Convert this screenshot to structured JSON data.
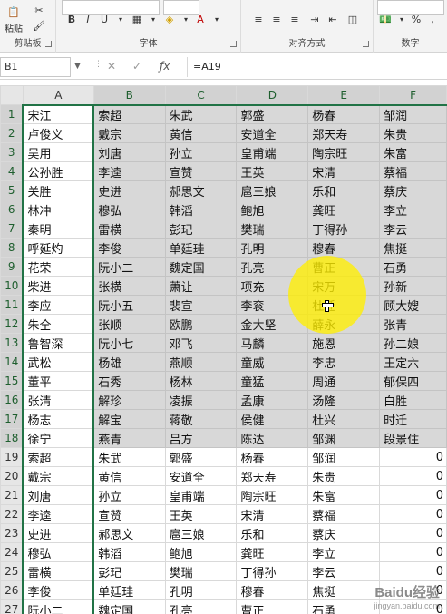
{
  "ribbon": {
    "clipboard_label": "剪贴板",
    "paste_label": "粘贴",
    "font_label": "字体",
    "alignment_label": "对齐方式",
    "number_label": "数字",
    "bold": "B",
    "italic": "I",
    "underline": "U",
    "font_color": "A",
    "percent": "%",
    "comma": ","
  },
  "formula_bar": {
    "name_box": "B1",
    "formula": "=A19"
  },
  "sheet": {
    "columns": [
      "A",
      "B",
      "C",
      "D",
      "E",
      "F"
    ],
    "rows": [
      {
        "n": "1",
        "cells": [
          "宋江",
          "索超",
          "朱武",
          "郭盛",
          "杨春",
          "邹润"
        ]
      },
      {
        "n": "2",
        "cells": [
          "卢俊义",
          "戴宗",
          "黄信",
          "安道全",
          "郑天寿",
          "朱贵"
        ]
      },
      {
        "n": "3",
        "cells": [
          "吴用",
          "刘唐",
          "孙立",
          "皇甫端",
          "陶宗旺",
          "朱富"
        ]
      },
      {
        "n": "4",
        "cells": [
          "公孙胜",
          "李逵",
          "宣赞",
          "王英",
          "宋清",
          "蔡福"
        ]
      },
      {
        "n": "5",
        "cells": [
          "关胜",
          "史进",
          "郝思文",
          "扈三娘",
          "乐和",
          "蔡庆"
        ]
      },
      {
        "n": "6",
        "cells": [
          "林冲",
          "穆弘",
          "韩滔",
          "鲍旭",
          "龚旺",
          "李立"
        ]
      },
      {
        "n": "7",
        "cells": [
          "秦明",
          "雷横",
          "彭玘",
          "樊瑞",
          "丁得孙",
          "李云"
        ]
      },
      {
        "n": "8",
        "cells": [
          "呼延灼",
          "李俊",
          "单廷珪",
          "孔明",
          "穆春",
          "焦挺"
        ]
      },
      {
        "n": "9",
        "cells": [
          "花荣",
          "阮小二",
          "魏定国",
          "孔亮",
          "曹正",
          "石勇"
        ]
      },
      {
        "n": "10",
        "cells": [
          "柴进",
          "张横",
          "萧让",
          "项充",
          "宋万",
          "孙新"
        ]
      },
      {
        "n": "11",
        "cells": [
          "李应",
          "阮小五",
          "裴宣",
          "李衮",
          "杜迁",
          "顾大嫂"
        ]
      },
      {
        "n": "12",
        "cells": [
          "朱仝",
          "张顺",
          "欧鹏",
          "金大坚",
          "薛永",
          "张青"
        ]
      },
      {
        "n": "13",
        "cells": [
          "鲁智深",
          "阮小七",
          "邓飞",
          "马麟",
          "施恩",
          "孙二娘"
        ]
      },
      {
        "n": "14",
        "cells": [
          "武松",
          "杨雄",
          "燕顺",
          "童威",
          "李忠",
          "王定六"
        ]
      },
      {
        "n": "15",
        "cells": [
          "董平",
          "石秀",
          "杨林",
          "童猛",
          "周通",
          "郁保四"
        ]
      },
      {
        "n": "16",
        "cells": [
          "张清",
          "解珍",
          "凌振",
          "孟康",
          "汤隆",
          "白胜"
        ]
      },
      {
        "n": "17",
        "cells": [
          "杨志",
          "解宝",
          "蒋敬",
          "侯健",
          "杜兴",
          "时迁"
        ]
      },
      {
        "n": "18",
        "cells": [
          "徐宁",
          "燕青",
          "吕方",
          "陈达",
          "邹渊",
          "段景住"
        ]
      },
      {
        "n": "19",
        "cells": [
          "索超",
          "朱武",
          "郭盛",
          "杨春",
          "邹润",
          "0"
        ]
      },
      {
        "n": "20",
        "cells": [
          "戴宗",
          "黄信",
          "安道全",
          "郑天寿",
          "朱贵",
          "0"
        ]
      },
      {
        "n": "21",
        "cells": [
          "刘唐",
          "孙立",
          "皇甫端",
          "陶宗旺",
          "朱富",
          "0"
        ]
      },
      {
        "n": "22",
        "cells": [
          "李逵",
          "宣赞",
          "王英",
          "宋清",
          "蔡福",
          "0"
        ]
      },
      {
        "n": "23",
        "cells": [
          "史进",
          "郝思文",
          "扈三娘",
          "乐和",
          "蔡庆",
          "0"
        ]
      },
      {
        "n": "24",
        "cells": [
          "穆弘",
          "韩滔",
          "鲍旭",
          "龚旺",
          "李立",
          "0"
        ]
      },
      {
        "n": "25",
        "cells": [
          "雷横",
          "彭玘",
          "樊瑞",
          "丁得孙",
          "李云",
          "0"
        ]
      },
      {
        "n": "26",
        "cells": [
          "李俊",
          "单廷珪",
          "孔明",
          "穆春",
          "焦挺",
          "0"
        ]
      },
      {
        "n": "27",
        "cells": [
          "阮小二",
          "魏定国",
          "孔亮",
          "曹正",
          "石勇",
          "0"
        ]
      }
    ]
  },
  "watermark": {
    "logo": "Baidu经验",
    "url": "jingyan.baidu.com"
  },
  "colors": {
    "accent": "#217346",
    "selection": "#d8d8d8",
    "highlight": "#ffee00"
  }
}
